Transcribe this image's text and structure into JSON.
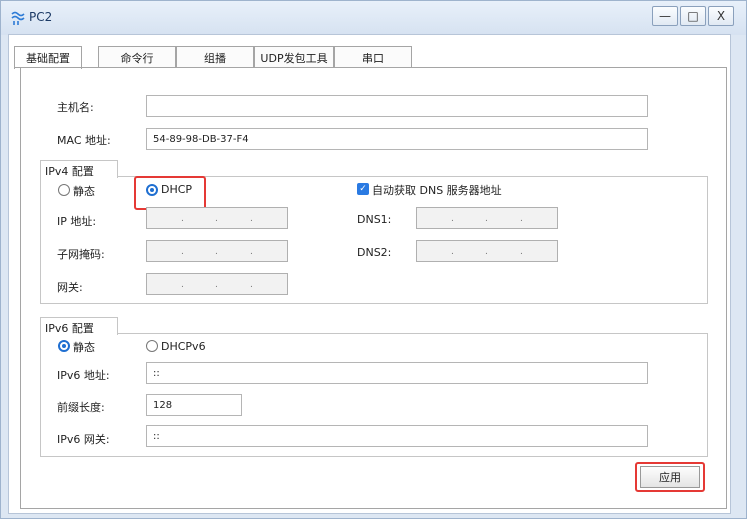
{
  "window": {
    "title": "PC2"
  },
  "tabs": [
    "基础配置",
    "命令行",
    "组播",
    "UDP发包工具",
    "串口"
  ],
  "basic": {
    "hostname_label": "主机名:",
    "hostname_value": "",
    "mac_label": "MAC 地址:",
    "mac_value": "54-89-98-DB-37-F4"
  },
  "ipv4": {
    "group_title": "IPv4 配置",
    "static_label": "静态",
    "dhcp_label": "DHCP",
    "selected": "DHCP",
    "auto_dns_label": "自动获取 DNS 服务器地址",
    "auto_dns_checked": true,
    "ip_label": "IP 地址:",
    "mask_label": "子网掩码:",
    "gateway_label": "网关:",
    "dns1_label": "DNS1:",
    "dns2_label": "DNS2:"
  },
  "ipv6": {
    "group_title": "IPv6 配置",
    "static_label": "静态",
    "dhcp_label": "DHCPv6",
    "selected": "静态",
    "addr_label": "IPv6 地址:",
    "addr_value": "::",
    "prefix_label": "前缀长度:",
    "prefix_value": "128",
    "gateway_label": "IPv6 网关:",
    "gateway_value": "::"
  },
  "apply_label": "应用",
  "colors": {
    "highlight": "#e53935",
    "accent": "#1f6fd1"
  }
}
